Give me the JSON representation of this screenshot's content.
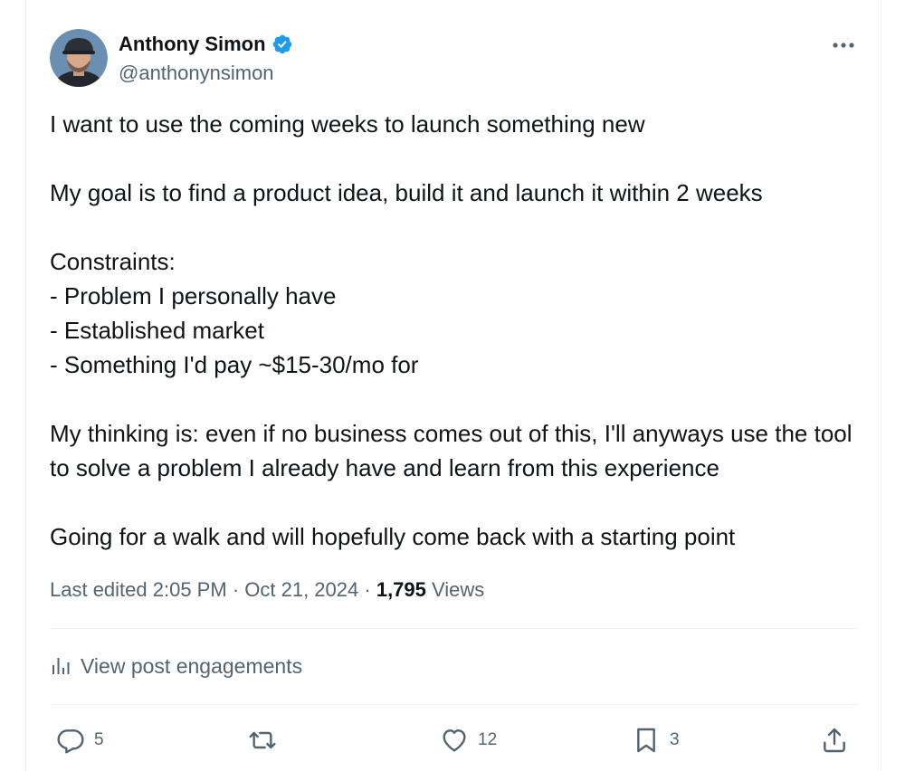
{
  "author": {
    "display_name": "Anthony Simon",
    "handle": "@anthonynsimon",
    "verified": true
  },
  "tweet": {
    "paragraphs": [
      "I want to use the coming weeks to launch something new",
      "",
      "My goal is to find a product idea, build it and launch it within 2 weeks",
      "",
      "Constraints:",
      "- Problem I personally have",
      "- Established market",
      "- Something I'd pay ~$15-30/mo for",
      "",
      "My thinking is: even if no business comes out of this, I'll anyways use the tool to solve a problem I already have and learn from this experience",
      "",
      "Going for a walk and will hopefully come back with a starting point"
    ]
  },
  "meta": {
    "edited_label": "Last edited 2:05 PM",
    "separator": "·",
    "date": "Oct 21, 2024",
    "views_count": "1,795",
    "views_label": "Views"
  },
  "engagements": {
    "label": "View post engagements"
  },
  "actions": {
    "replies": "5",
    "reposts": "",
    "likes": "12",
    "bookmarks": "3"
  },
  "colors": {
    "text": "#0f1419",
    "muted": "#536471",
    "verified": "#1d9bf0",
    "divider": "#eff3f4"
  },
  "icons": {
    "more": "more-horizontal-icon",
    "verified": "verified-badge-icon",
    "engagements": "bar-chart-icon",
    "reply": "reply-bubble-icon",
    "repost": "repost-arrows-icon",
    "like": "heart-icon",
    "bookmark": "bookmark-icon",
    "share": "share-upload-icon"
  }
}
